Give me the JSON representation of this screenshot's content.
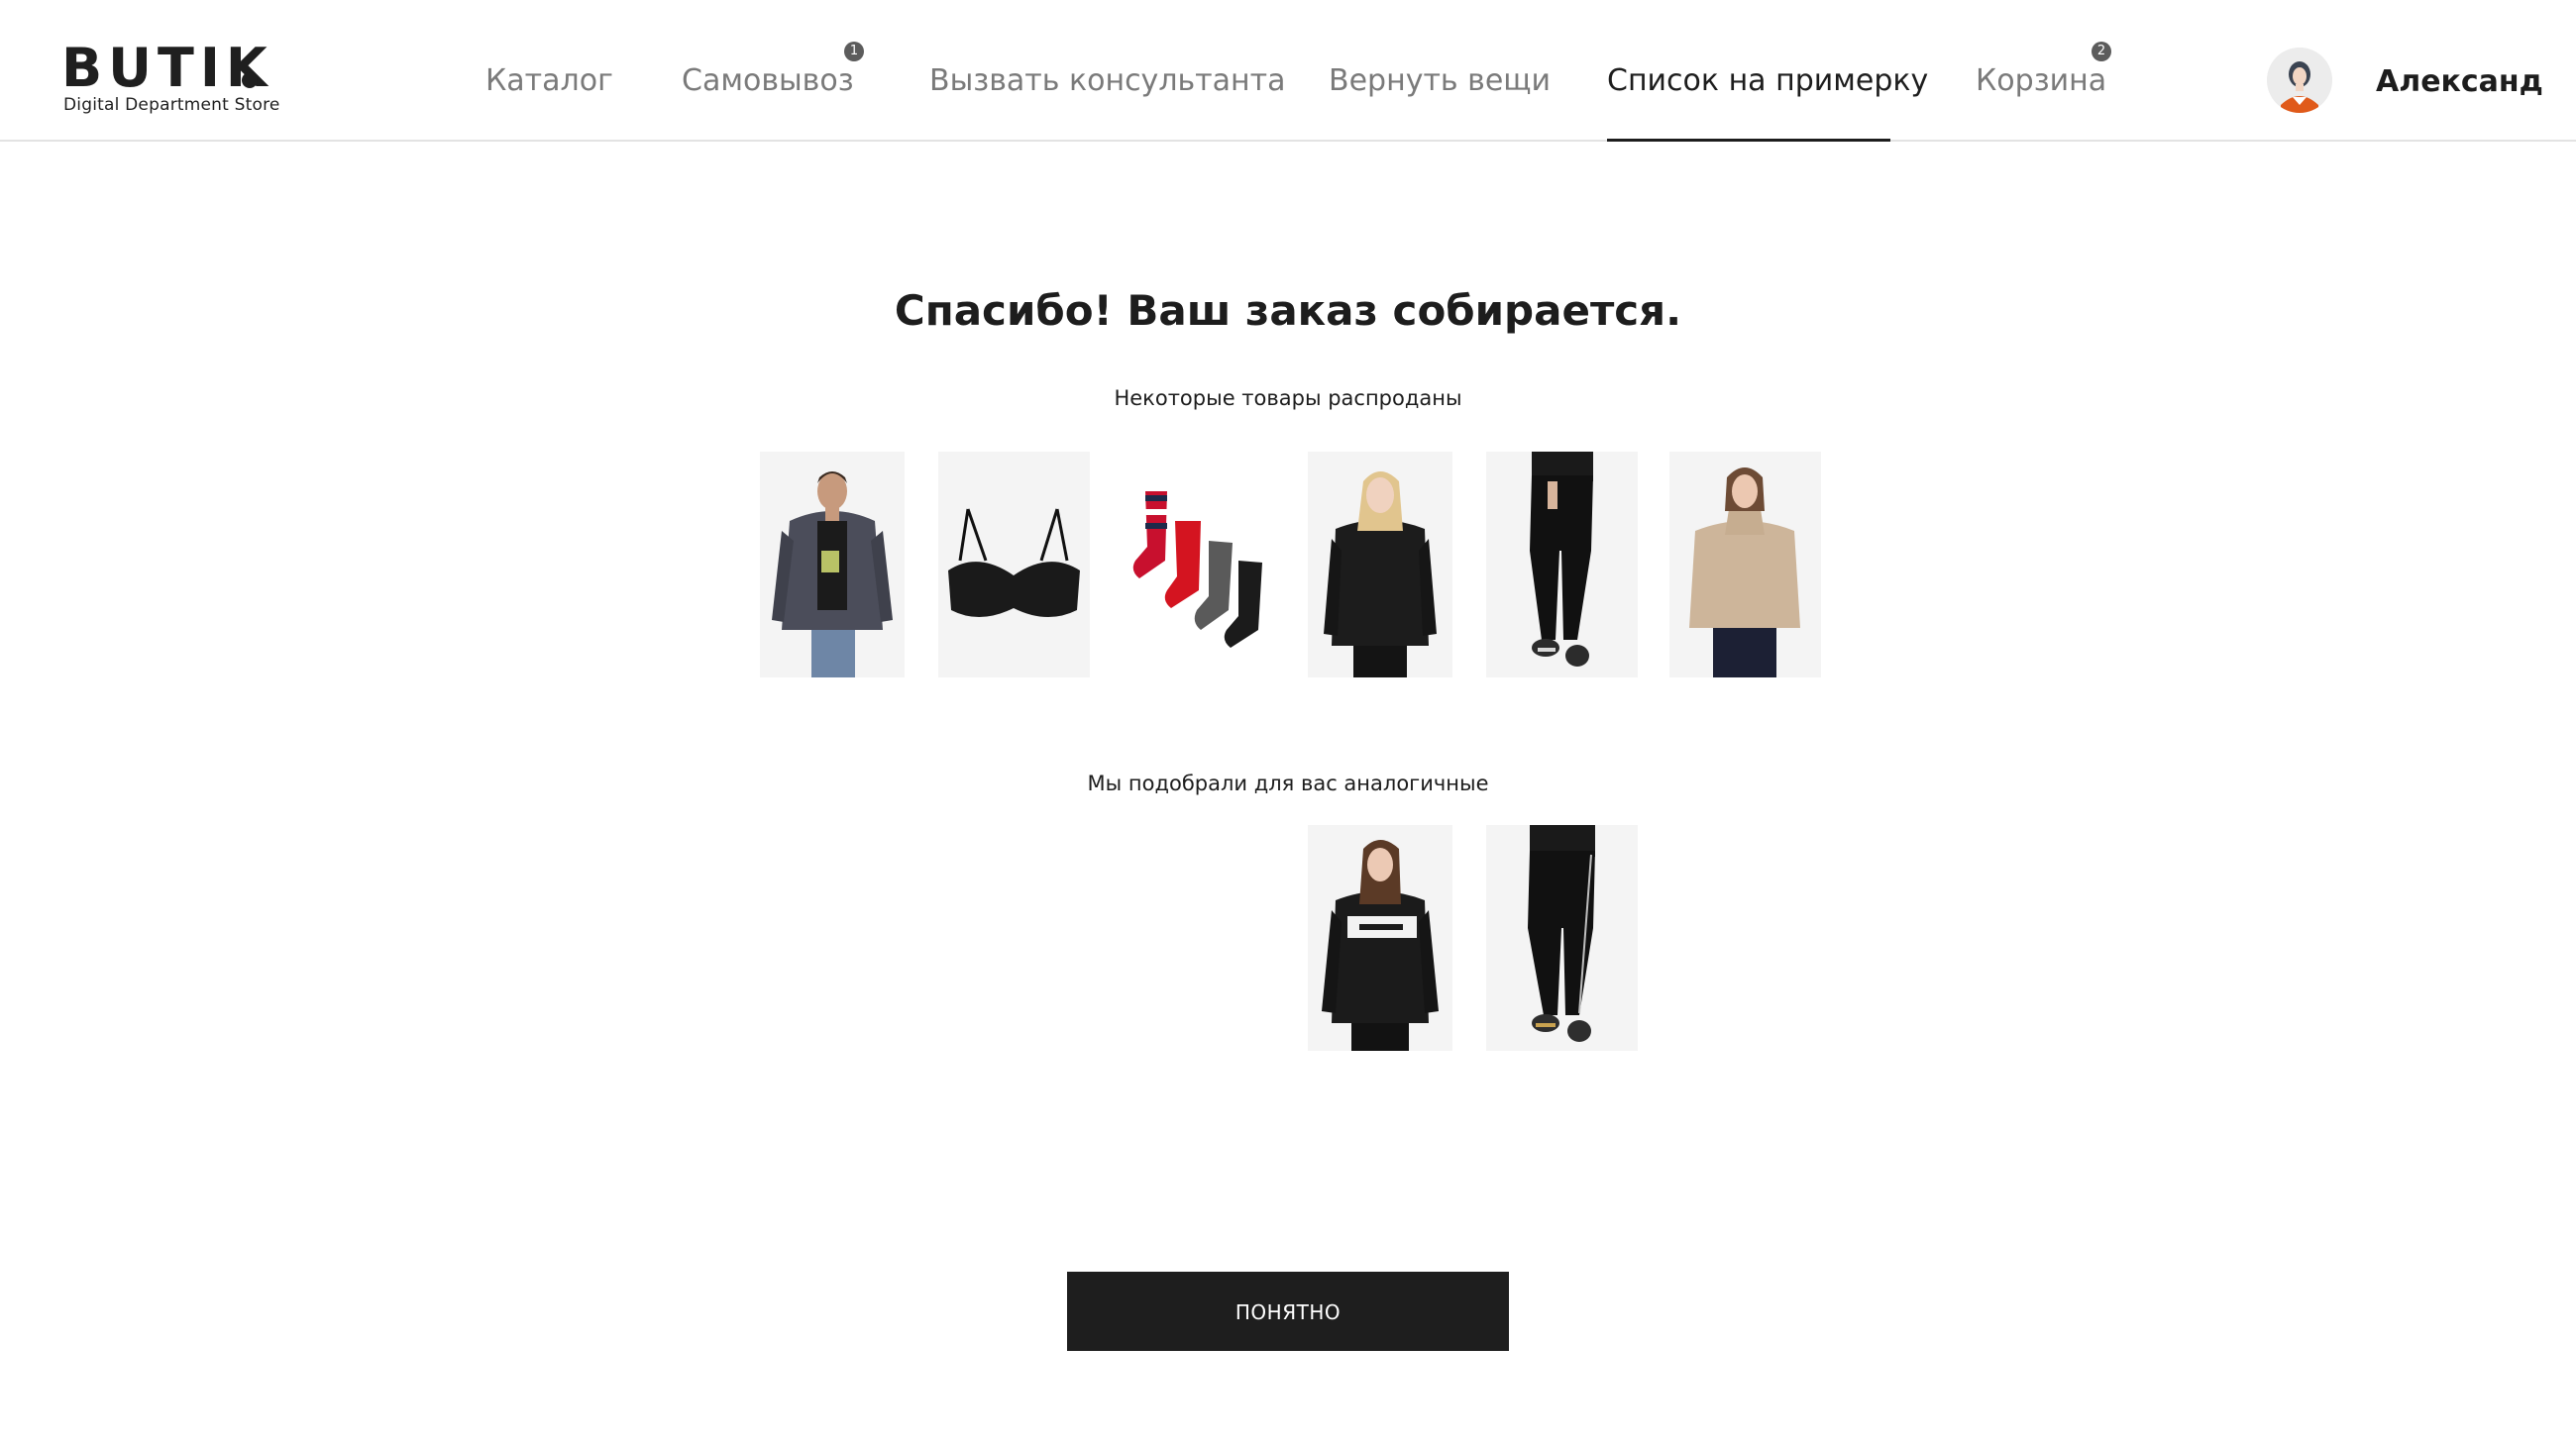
{
  "brand": {
    "name": "BUTIK",
    "tagline": "Digital Department Store"
  },
  "nav": {
    "items": [
      {
        "label": "Каталог"
      },
      {
        "label": "Самовывоз",
        "badge": "1"
      },
      {
        "label": "Вызвать консультанта"
      },
      {
        "label": "Вернуть вещи"
      },
      {
        "label": "Список на примерку",
        "active": true
      },
      {
        "label": "Корзина",
        "badge": "2"
      }
    ]
  },
  "user": {
    "name": "Александ",
    "avatar_icon": "user-avatar-icon"
  },
  "main": {
    "title": "Спасибо! Ваш заказ собирается.",
    "sold_out_caption": "Некоторые товары распроданы",
    "sold_out_items": [
      {
        "kind": "man-jacket-photo"
      },
      {
        "kind": "black-bra-photo"
      },
      {
        "kind": "socks-set-photo"
      },
      {
        "kind": "woman-black-hoodie-photo"
      },
      {
        "kind": "black-joggers-photo"
      },
      {
        "kind": "woman-beige-sweater-photo"
      }
    ],
    "similar_caption": "Мы подобрали для вас аналогичные",
    "similar_items": [
      {
        "kind": "woman-black-sweatshirt-photo"
      },
      {
        "kind": "black-track-pants-photo"
      }
    ],
    "confirm_label": "ПОНЯТНО"
  },
  "colors": {
    "accent": "#1e1e1e",
    "muted_nav": "#7a7a7a",
    "divider": "#e3e3e3",
    "product_bg": "#f4f4f4"
  }
}
